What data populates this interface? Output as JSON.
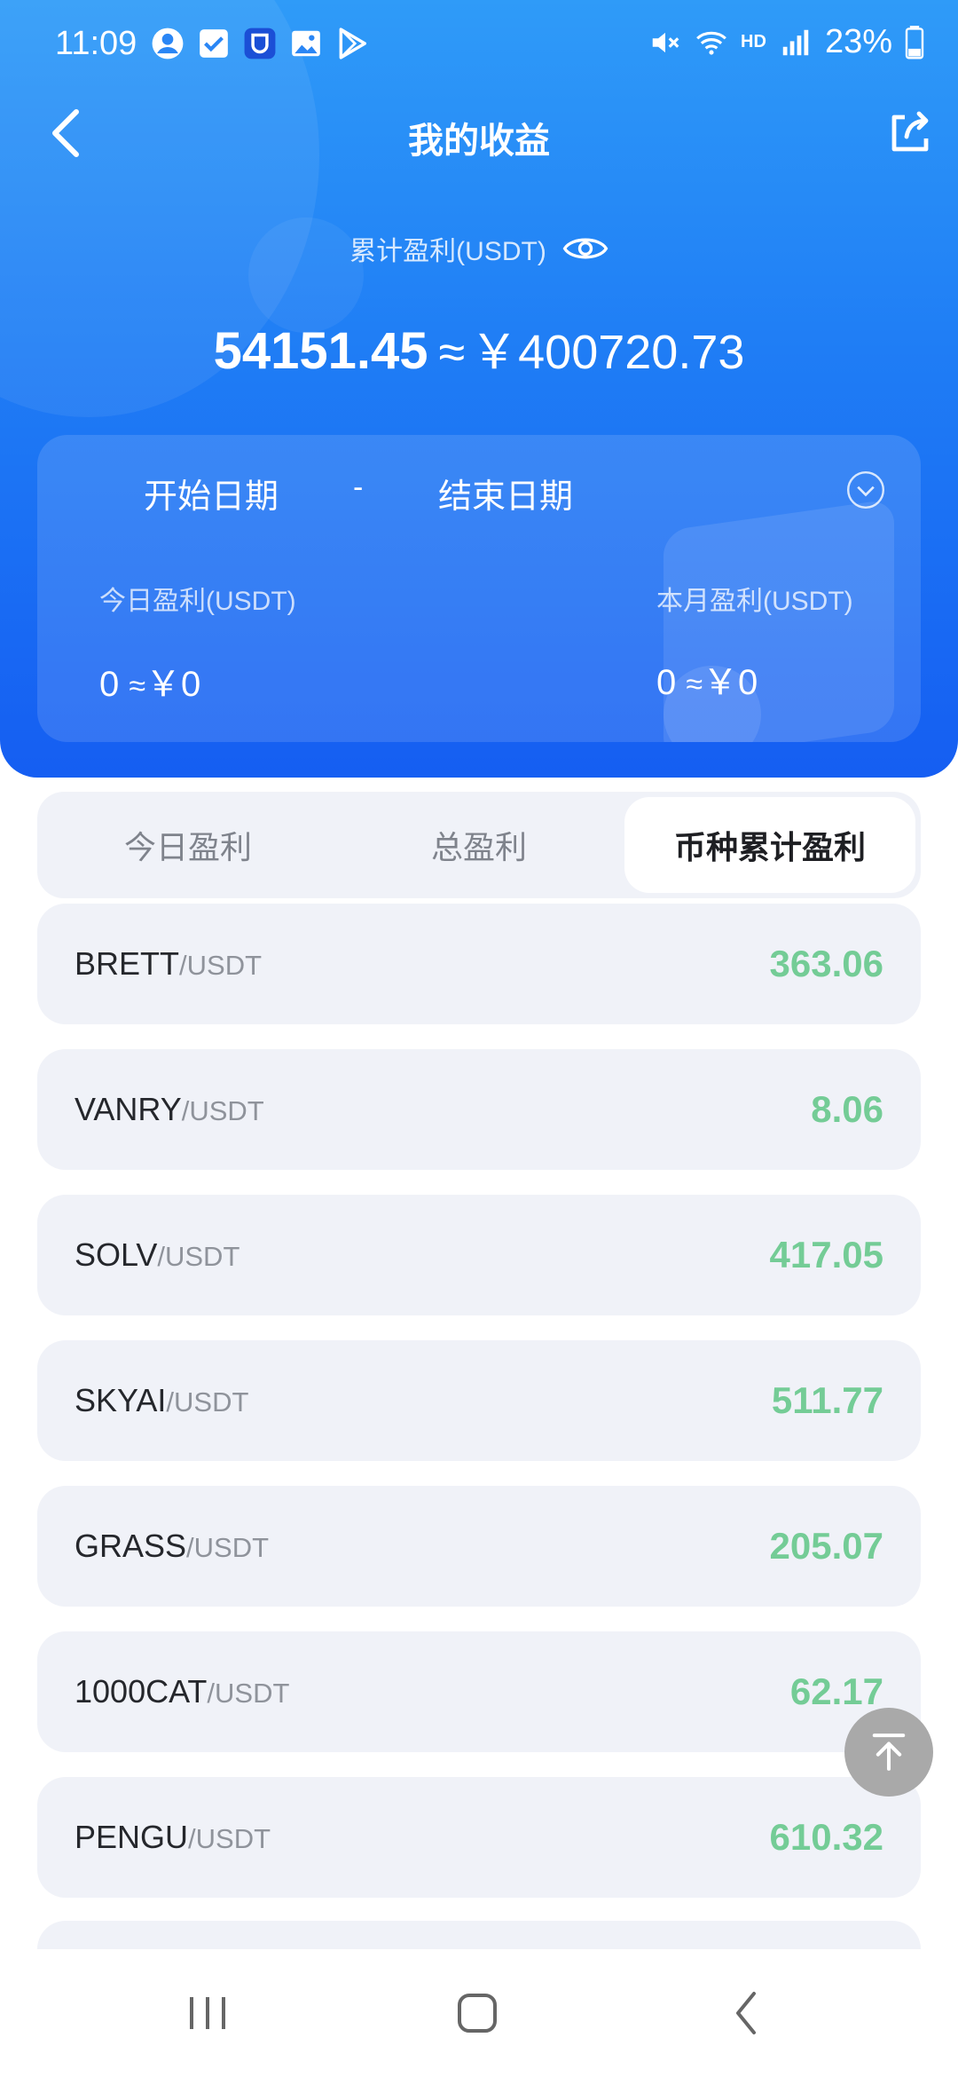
{
  "status_bar": {
    "time": "11:09",
    "battery": "23%",
    "network": "HD"
  },
  "nav": {
    "title": "我的收益"
  },
  "summary": {
    "label": "累计盈利(USDT)",
    "usdt_value": "54151.45",
    "approx": "≈",
    "cny_value": "￥400720.73"
  },
  "date_filter": {
    "start": "开始日期",
    "separator": "-",
    "end": "结束日期"
  },
  "stats": {
    "today_label": "今日盈利(USDT)",
    "today_value": "0",
    "today_cny": "￥0",
    "month_label": "本月盈利(USDT)",
    "month_value": "0",
    "month_cny": "￥0",
    "approx": "≈"
  },
  "tabs": [
    {
      "label": "今日盈利",
      "active": false
    },
    {
      "label": "总盈利",
      "active": false
    },
    {
      "label": "币种累计盈利",
      "active": true
    }
  ],
  "list": [
    {
      "symbol": "BRETT",
      "pair": "/USDT",
      "value": "363.06"
    },
    {
      "symbol": "VANRY",
      "pair": "/USDT",
      "value": "8.06"
    },
    {
      "symbol": "SOLV",
      "pair": "/USDT",
      "value": "417.05"
    },
    {
      "symbol": "SKYAI",
      "pair": "/USDT",
      "value": "511.77"
    },
    {
      "symbol": "GRASS",
      "pair": "/USDT",
      "value": "205.07"
    },
    {
      "symbol": "1000CAT",
      "pair": "/USDT",
      "value": "62.17"
    },
    {
      "symbol": "PENGU",
      "pair": "/USDT",
      "value": "610.32"
    }
  ],
  "colors": {
    "header_blue": "#1f7df5",
    "profit_green": "#74cc96",
    "row_bg": "#f0f2f8"
  }
}
